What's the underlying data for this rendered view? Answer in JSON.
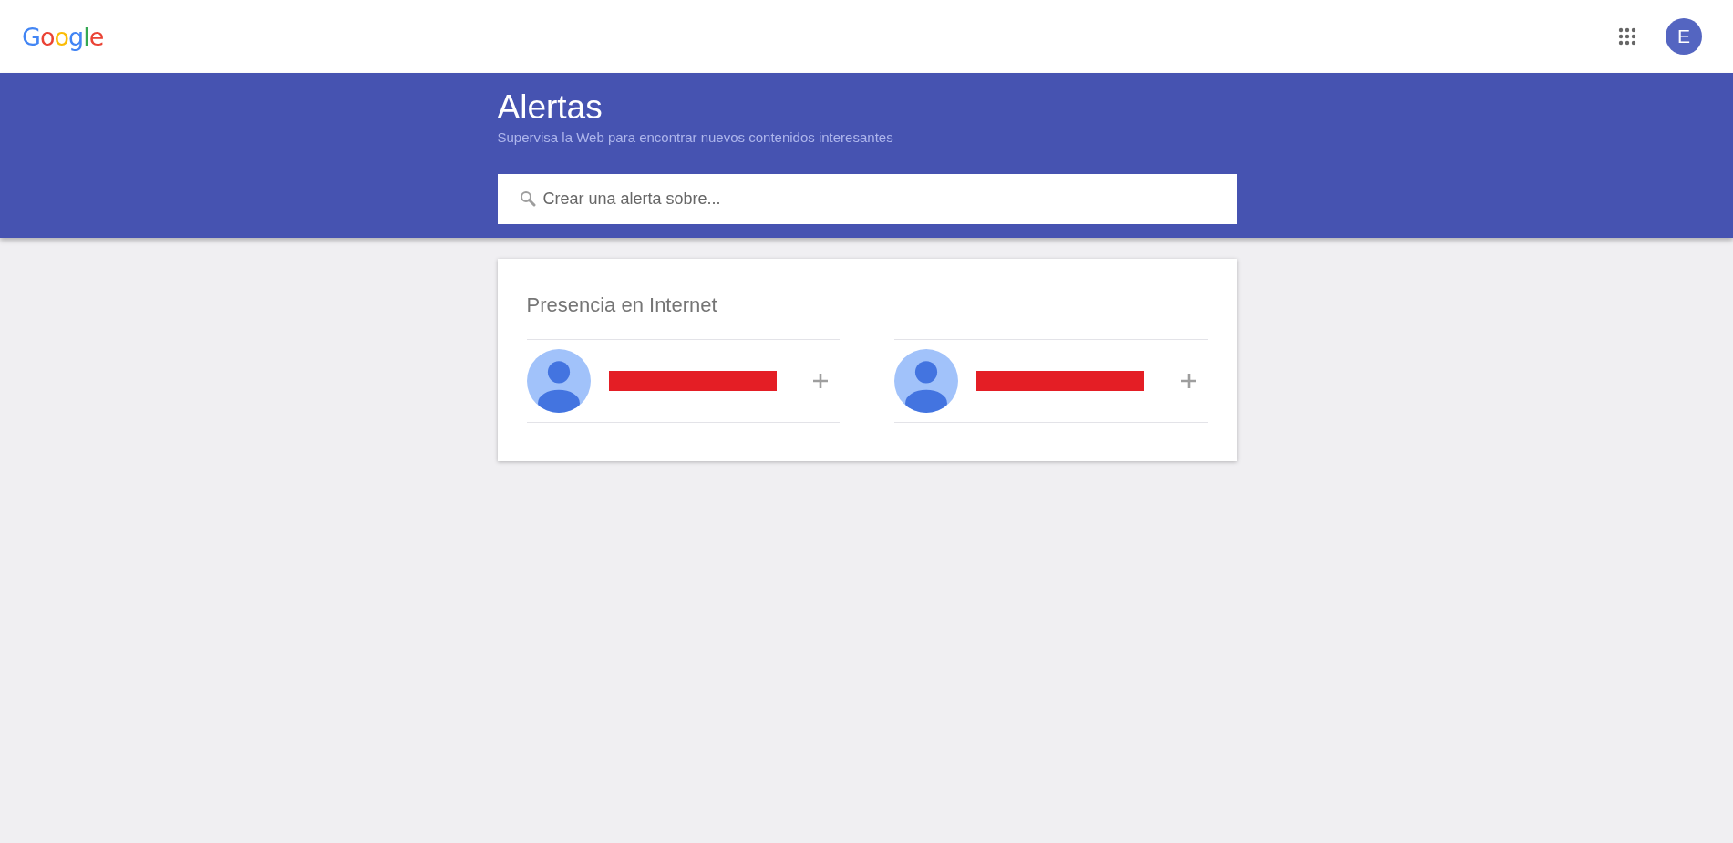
{
  "header": {
    "logo": "Google",
    "account_initial": "E"
  },
  "banner": {
    "title": "Alertas",
    "subtitle": "Supervisa la Web para encontrar nuevos contenidos interesantes"
  },
  "search": {
    "placeholder": "Crear una alerta sobre..."
  },
  "presence": {
    "title": "Presencia en Internet",
    "profiles": [
      {
        "kind": "redacted"
      },
      {
        "kind": "redacted"
      }
    ]
  }
}
